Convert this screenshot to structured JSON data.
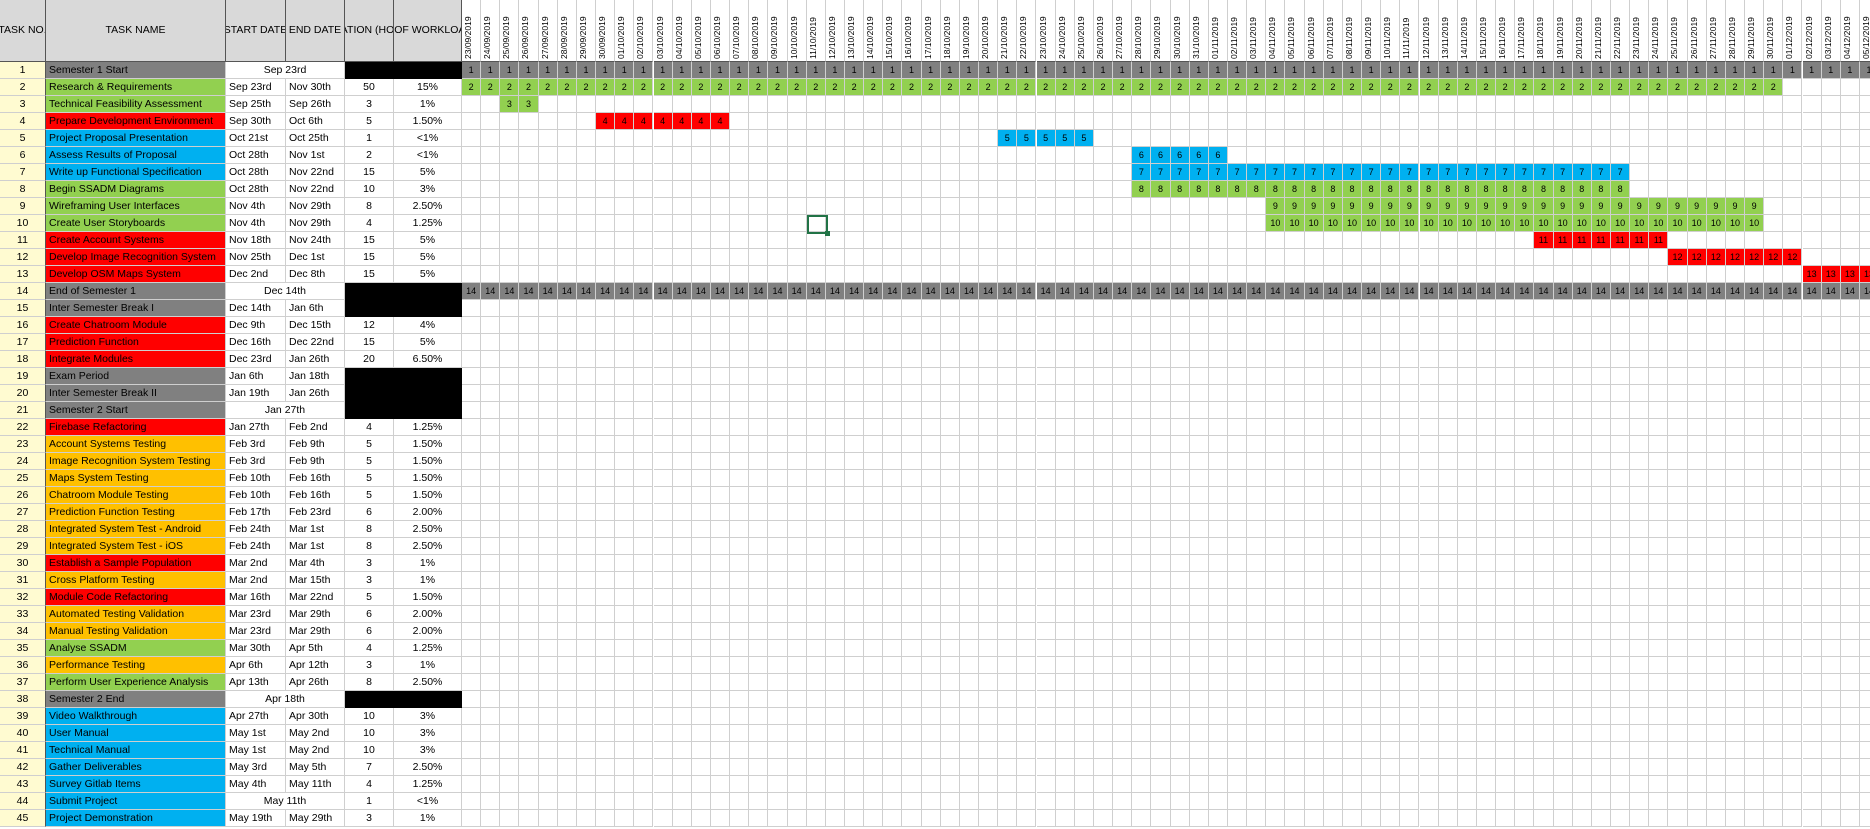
{
  "headers": {
    "task_no": "TASK NO.",
    "task_name": "TASK NAME",
    "start_date": "START DATE",
    "end_date": "END DATE",
    "duration": "DURATION (HOURS)",
    "workload": "% OF WORKLOAD"
  },
  "colors": {
    "green": "#92d050",
    "red": "#ff0000",
    "blue": "#00b0f0",
    "orange": "#ffc000",
    "gray": "#808080",
    "black": "#000000",
    "header": "#d9d9d9"
  },
  "date_columns": [
    "23/09/2019",
    "24/09/2019",
    "25/09/2019",
    "26/09/2019",
    "27/09/2019",
    "28/09/2019",
    "29/09/2019",
    "30/09/2019",
    "01/10/2019",
    "02/10/2019",
    "03/10/2019",
    "04/10/2019",
    "05/10/2019",
    "06/10/2019",
    "07/10/2019",
    "08/10/2019",
    "09/10/2019",
    "10/10/2019",
    "11/10/2019",
    "12/10/2019",
    "13/10/2019",
    "14/10/2019",
    "15/10/2019",
    "16/10/2019",
    "17/10/2019",
    "18/10/2019",
    "19/10/2019",
    "20/10/2019",
    "21/10/2019",
    "22/10/2019",
    "23/10/2019",
    "24/10/2019",
    "25/10/2019",
    "26/10/2019",
    "27/10/2019",
    "28/10/2019",
    "29/10/2019",
    "30/10/2019",
    "31/10/2019",
    "01/11/2019",
    "02/11/2019",
    "03/11/2019",
    "04/11/2019",
    "05/11/2019",
    "06/11/2019",
    "07/11/2019",
    "08/11/2019",
    "09/11/2019",
    "10/11/2019",
    "11/11/2019",
    "12/11/2019",
    "13/11/2019",
    "14/11/2019",
    "15/11/2019",
    "16/11/2019",
    "17/11/2019",
    "18/11/2019",
    "19/11/2019",
    "20/11/2019",
    "21/11/2019",
    "22/11/2019",
    "23/11/2019",
    "24/11/2019",
    "25/11/2019",
    "26/11/2019",
    "27/11/2019",
    "28/11/2019",
    "29/11/2019",
    "30/11/2019",
    "01/12/2019",
    "02/12/2019",
    "03/12/2019",
    "04/12/2019",
    "05/12/2019"
  ],
  "tasks": [
    {
      "no": "1",
      "name": "Semester 1 Start",
      "color": "gray",
      "merged_date": "Sep 23rd",
      "black_tail": true,
      "bar": {
        "value": "1",
        "color": "gray",
        "from": 0,
        "to": 73
      }
    },
    {
      "no": "2",
      "name": "Research & Requirements",
      "color": "green",
      "start": "Sep 23rd",
      "end": "Nov 30th",
      "dur": "50",
      "pct": "15%",
      "bar": {
        "value": "2",
        "color": "green",
        "from": 0,
        "to": 68
      }
    },
    {
      "no": "3",
      "name": "Technical Feasibility Assessment",
      "color": "green",
      "start": "Sep 25th",
      "end": "Sep 26th",
      "dur": "3",
      "pct": "1%",
      "bar": {
        "value": "3",
        "color": "green",
        "from": 2,
        "to": 3
      }
    },
    {
      "no": "4",
      "name": "Prepare Development Environment",
      "color": "red",
      "start": "Sep 30th",
      "end": "Oct 6th",
      "dur": "5",
      "pct": "1.50%",
      "bar": {
        "value": "4",
        "color": "red",
        "from": 7,
        "to": 13
      }
    },
    {
      "no": "5",
      "name": "Project Proposal Presentation",
      "color": "blue",
      "start": "Oct 21st",
      "end": "Oct 25th",
      "dur": "1",
      "pct": "<1%",
      "bar": {
        "value": "5",
        "color": "blue",
        "from": 28,
        "to": 32
      }
    },
    {
      "no": "6",
      "name": "Assess Results of Proposal",
      "color": "blue",
      "start": "Oct 28th",
      "end": "Nov 1st",
      "dur": "2",
      "pct": "<1%",
      "bar": {
        "value": "6",
        "color": "blue",
        "from": 35,
        "to": 39
      }
    },
    {
      "no": "7",
      "name": "Write up Functional Specification",
      "color": "blue",
      "start": "Oct 28th",
      "end": "Nov 22nd",
      "dur": "15",
      "pct": "5%",
      "bar": {
        "value": "7",
        "color": "blue",
        "from": 35,
        "to": 60
      }
    },
    {
      "no": "8",
      "name": "Begin SSADM Diagrams",
      "color": "green",
      "start": "Oct 28th",
      "end": "Nov 22nd",
      "dur": "10",
      "pct": "3%",
      "bar": {
        "value": "8",
        "color": "green",
        "from": 35,
        "to": 60
      }
    },
    {
      "no": "9",
      "name": "Wireframing User Interfaces",
      "color": "green",
      "start": "Nov 4th",
      "end": "Nov 29th",
      "dur": "8",
      "pct": "2.50%",
      "bar": {
        "value": "9",
        "color": "green",
        "from": 42,
        "to": 67
      }
    },
    {
      "no": "10",
      "name": "Create User Storyboards",
      "color": "green",
      "start": "Nov 4th",
      "end": "Nov 29th",
      "dur": "4",
      "pct": "1.25%",
      "bar": {
        "value": "10",
        "color": "green",
        "from": 42,
        "to": 67
      }
    },
    {
      "no": "11",
      "name": "Create Account Systems",
      "color": "red",
      "start": "Nov 18th",
      "end": "Nov 24th",
      "dur": "15",
      "pct": "5%",
      "bar": {
        "value": "11",
        "color": "red",
        "from": 56,
        "to": 62
      }
    },
    {
      "no": "12",
      "name": "Develop Image Recognition System",
      "color": "red",
      "start": "Nov 25th",
      "end": "Dec 1st",
      "dur": "15",
      "pct": "5%",
      "bar": {
        "value": "12",
        "color": "red",
        "from": 63,
        "to": 69
      }
    },
    {
      "no": "13",
      "name": "Develop OSM Maps System",
      "color": "red",
      "start": "Dec 2nd",
      "end": "Dec 8th",
      "dur": "15",
      "pct": "5%",
      "bar": {
        "value": "13",
        "color": "red",
        "from": 70,
        "to": 73
      }
    },
    {
      "no": "14",
      "name": "End of Semester 1",
      "color": "gray",
      "merged_date": "Dec 14th",
      "black_tail": true,
      "bar": {
        "value": "14",
        "color": "gray",
        "from": 0,
        "to": 73
      }
    },
    {
      "no": "15",
      "name": "Inter Semester Break I",
      "color": "gray",
      "start": "Dec 14th",
      "end": "Jan 6th",
      "black_tail": true
    },
    {
      "no": "16",
      "name": "Create Chatroom Module",
      "color": "red",
      "start": "Dec 9th",
      "end": "Dec 15th",
      "dur": "12",
      "pct": "4%"
    },
    {
      "no": "17",
      "name": "Prediction Function",
      "color": "red",
      "start": "Dec 16th",
      "end": "Dec 22nd",
      "dur": "15",
      "pct": "5%"
    },
    {
      "no": "18",
      "name": "Integrate Modules",
      "color": "red",
      "start": "Dec 23rd",
      "end": "Jan 26th",
      "dur": "20",
      "pct": "6.50%"
    },
    {
      "no": "19",
      "name": "Exam Period",
      "color": "gray",
      "start": "Jan 6th",
      "end": "Jan 18th",
      "black_tail": true
    },
    {
      "no": "20",
      "name": "Inter Semester Break II",
      "color": "gray",
      "start": "Jan 19th",
      "end": "Jan 26th",
      "black_tail": true
    },
    {
      "no": "21",
      "name": "Semester 2 Start",
      "color": "gray",
      "merged_date": "Jan 27th",
      "black_tail": true
    },
    {
      "no": "22",
      "name": "Firebase Refactoring",
      "color": "red",
      "start": "Jan 27th",
      "end": "Feb 2nd",
      "dur": "4",
      "pct": "1.25%"
    },
    {
      "no": "23",
      "name": "Account Systems Testing",
      "color": "orange",
      "start": "Feb 3rd",
      "end": "Feb 9th",
      "dur": "5",
      "pct": "1.50%"
    },
    {
      "no": "24",
      "name": "Image Recognition System Testing",
      "color": "orange",
      "start": "Feb 3rd",
      "end": "Feb 9th",
      "dur": "5",
      "pct": "1.50%"
    },
    {
      "no": "25",
      "name": "Maps System Testing",
      "color": "orange",
      "start": "Feb 10th",
      "end": "Feb 16th",
      "dur": "5",
      "pct": "1.50%"
    },
    {
      "no": "26",
      "name": "Chatroom Module Testing",
      "color": "orange",
      "start": "Feb 10th",
      "end": "Feb 16th",
      "dur": "5",
      "pct": "1.50%"
    },
    {
      "no": "27",
      "name": "Prediction Function Testing",
      "color": "orange",
      "start": "Feb 17th",
      "end": "Feb 23rd",
      "dur": "6",
      "pct": "2.00%"
    },
    {
      "no": "28",
      "name": "Integrated System Test - Android",
      "color": "orange",
      "start": "Feb 24th",
      "end": "Mar 1st",
      "dur": "8",
      "pct": "2.50%"
    },
    {
      "no": "29",
      "name": "Integrated System Test - iOS",
      "color": "orange",
      "start": "Feb 24th",
      "end": "Mar 1st",
      "dur": "8",
      "pct": "2.50%"
    },
    {
      "no": "30",
      "name": "Establish a Sample Population",
      "color": "red",
      "start": "Mar 2nd",
      "end": "Mar 4th",
      "dur": "3",
      "pct": "1%"
    },
    {
      "no": "31",
      "name": "Cross Platform Testing",
      "color": "orange",
      "start": "Mar 2nd",
      "end": "Mar 15th",
      "dur": "3",
      "pct": "1%"
    },
    {
      "no": "32",
      "name": "Module Code Refactoring",
      "color": "red",
      "start": "Mar 16th",
      "end": "Mar 22nd",
      "dur": "5",
      "pct": "1.50%"
    },
    {
      "no": "33",
      "name": "Automated Testing Validation",
      "color": "orange",
      "start": "Mar 23rd",
      "end": "Mar 29th",
      "dur": "6",
      "pct": "2.00%"
    },
    {
      "no": "34",
      "name": "Manual Testing Validation",
      "color": "orange",
      "start": "Mar 23rd",
      "end": "Mar 29th",
      "dur": "6",
      "pct": "2.00%"
    },
    {
      "no": "35",
      "name": "Analyse SSADM",
      "color": "green",
      "start": "Mar 30th",
      "end": "Apr 5th",
      "dur": "4",
      "pct": "1.25%"
    },
    {
      "no": "36",
      "name": "Performance Testing",
      "color": "orange",
      "start": "Apr 6th",
      "end": "Apr 12th",
      "dur": "3",
      "pct": "1%"
    },
    {
      "no": "37",
      "name": "Perform User Experience Analysis",
      "color": "green",
      "start": "Apr 13th",
      "end": "Apr 26th",
      "dur": "8",
      "pct": "2.50%"
    },
    {
      "no": "38",
      "name": "Semester 2 End",
      "color": "gray",
      "merged_date": "Apr 18th",
      "black_tail": true
    },
    {
      "no": "39",
      "name": "Video Walkthrough",
      "color": "blue",
      "start": "Apr 27th",
      "end": "Apr 30th",
      "dur": "10",
      "pct": "3%"
    },
    {
      "no": "40",
      "name": "User Manual",
      "color": "blue",
      "start": "May 1st",
      "end": "May 2nd",
      "dur": "10",
      "pct": "3%"
    },
    {
      "no": "41",
      "name": "Technical Manual",
      "color": "blue",
      "start": "May 1st",
      "end": "May 2nd",
      "dur": "10",
      "pct": "3%"
    },
    {
      "no": "42",
      "name": "Gather Deliverables",
      "color": "blue",
      "start": "May 3rd",
      "end": "May 5th",
      "dur": "7",
      "pct": "2.50%"
    },
    {
      "no": "43",
      "name": "Survey Gitlab Items",
      "color": "blue",
      "start": "May 4th",
      "end": "May 11th",
      "dur": "4",
      "pct": "1.25%"
    },
    {
      "no": "44",
      "name": "Submit Project",
      "color": "blue",
      "merged_date": "May 11th",
      "dur": "1",
      "pct": "<1%"
    },
    {
      "no": "45",
      "name": "Project Demonstration",
      "color": "blue",
      "start": "May 19th",
      "end": "May 29th",
      "dur": "3",
      "pct": "1%"
    }
  ]
}
